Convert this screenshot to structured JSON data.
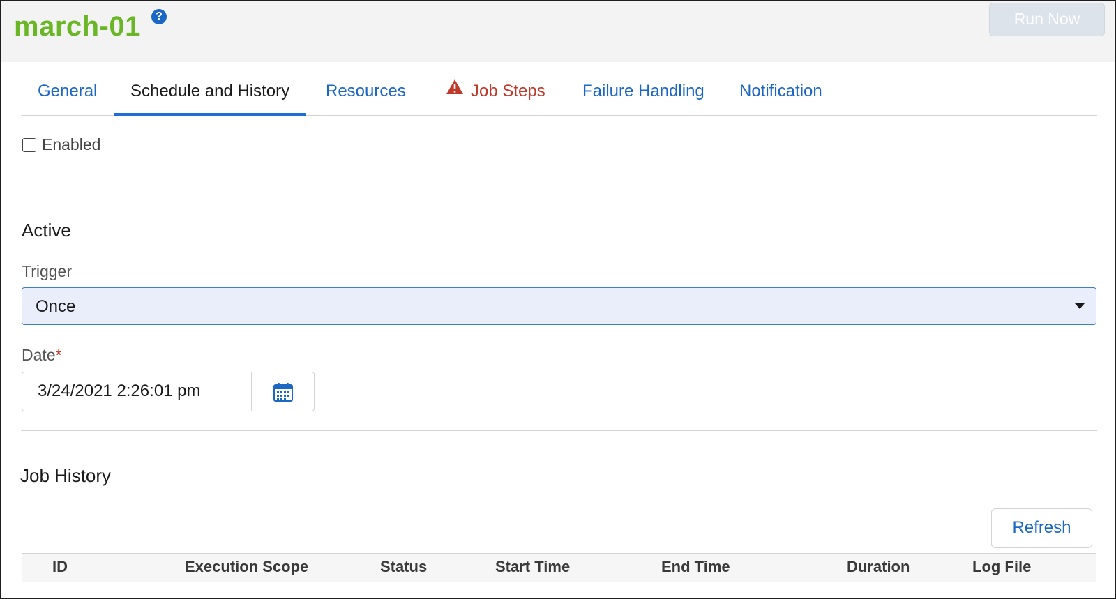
{
  "header": {
    "title": "march-01",
    "help_icon": "?",
    "run_now_label": "Run Now"
  },
  "tabs": [
    {
      "label": "General",
      "active": false
    },
    {
      "label": "Schedule and History",
      "active": true
    },
    {
      "label": "Resources",
      "active": false
    },
    {
      "label": "Job Steps",
      "active": false,
      "warning": true
    },
    {
      "label": "Failure Handling",
      "active": false
    },
    {
      "label": "Notification",
      "active": false
    }
  ],
  "enabled": {
    "label": "Enabled",
    "checked": false
  },
  "active_section": {
    "title": "Active",
    "trigger": {
      "label": "Trigger",
      "value": "Once"
    },
    "date": {
      "label": "Date",
      "required_mark": "*",
      "value": "3/24/2021 2:26:01 pm"
    }
  },
  "job_history": {
    "title": "Job History",
    "refresh_label": "Refresh",
    "columns": [
      "ID",
      "Execution Scope",
      "Status",
      "Start Time",
      "End Time",
      "Duration",
      "Log File"
    ]
  },
  "colors": {
    "title_green": "#6bb626",
    "link_blue": "#1a67c4",
    "warning_red": "#c0392b",
    "tab_underline": "#1f6ed6"
  },
  "icons": {
    "help": "help-icon",
    "warning": "warning-triangle-icon",
    "calendar": "calendar-icon",
    "dropdown": "chevron-down-icon"
  }
}
